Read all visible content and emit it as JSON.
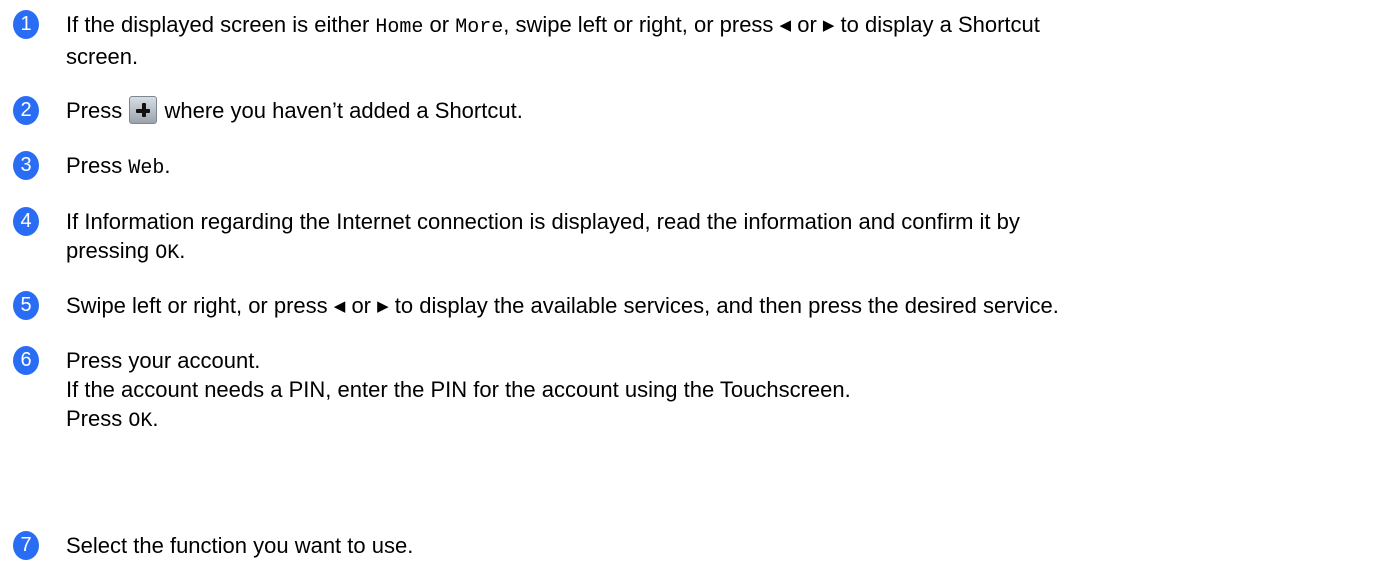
{
  "accent_color": "#2a6df5",
  "steps": [
    {
      "number": "1",
      "line1": {
        "a": "If the displayed screen is either ",
        "home": "Home",
        "b": " or ",
        "more": "More",
        "c": ", swipe left or right, or press ",
        "left_arrow": "◀",
        "d": " or ",
        "right_arrow": "▶",
        "e": " to display a Shortcut"
      },
      "line2": "screen."
    },
    {
      "number": "2",
      "a": "Press ",
      "icon": "plus-button-icon",
      "b": " where you haven’t added a Shortcut."
    },
    {
      "number": "3",
      "a": "Press ",
      "web": "Web",
      "b": "."
    },
    {
      "number": "4",
      "line1": "If Information regarding the Internet connection is displayed, read the information and confirm it by",
      "line2a": "pressing ",
      "ok": "OK",
      "line2b": "."
    },
    {
      "number": "5",
      "a": "Swipe left or right, or press ",
      "left_arrow": "◀",
      "b": " or ",
      "right_arrow": "▶",
      "c": " to display the available services, and then press the desired service."
    },
    {
      "number": "6",
      "line1": "Press your account.",
      "line2": "If the account needs a PIN, enter the PIN for the account using the Touchscreen.",
      "line3a": "Press ",
      "ok": "OK",
      "line3b": "."
    },
    {
      "number": "7",
      "text": "Select the function you want to use."
    }
  ]
}
